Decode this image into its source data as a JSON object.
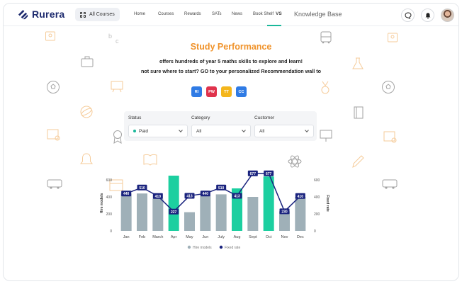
{
  "brand": {
    "name": "Rurera"
  },
  "nav": {
    "all_courses": "All Courses",
    "items": [
      "Home",
      "Courses",
      "Rewards",
      "SATs",
      "News",
      "Book Shelf"
    ],
    "vs": "VS",
    "knowledge_base": "Knowledge Base"
  },
  "icons": {
    "logo": "rurera-logo-icon",
    "grid": "grid-icon",
    "chat": "chat-icon",
    "bell": "bell-icon",
    "avatar": "user-avatar"
  },
  "hero": {
    "title": "Study Performance",
    "line1": "offers hundreds of year 5 maths skills to explore and learn!",
    "line2": "not sure where to start? GO to your personalized Recommendation wall to"
  },
  "chips": [
    {
      "label": "RI",
      "color": "#2f7be5"
    },
    {
      "label": "PW",
      "color": "#e0334c"
    },
    {
      "label": "TT",
      "color": "#f4b61c"
    },
    {
      "label": "CC",
      "color": "#2f7be5"
    }
  ],
  "filters": {
    "status": {
      "label": "Status",
      "value": "Paid"
    },
    "category": {
      "label": "Category",
      "value": "All"
    },
    "customer": {
      "label": "Customer",
      "value": "All"
    }
  },
  "colors": {
    "accent_orange": "#f0932b",
    "bar_gray": "#9fb0b8",
    "bar_green": "#1ccfa0",
    "line_navy": "#1a237e"
  },
  "chart_data": {
    "type": "bar",
    "categories": [
      "Jan",
      "Feb",
      "March",
      "Apr",
      "May",
      "Jun",
      "July",
      "Aug",
      "Sept",
      "Oct",
      "Nov",
      "Dec"
    ],
    "ylabel_left": "Hire models",
    "ylabel_right": "Fixed rate",
    "yticks": [
      0,
      200,
      400,
      600
    ],
    "ylim": [
      0,
      650
    ],
    "series": [
      {
        "name": "Hire models",
        "kind": "bar",
        "values": [
          440,
          440,
          380,
          650,
          220,
          410,
          430,
          500,
          400,
          640,
          230,
          400
        ],
        "highlight": [
          false,
          false,
          false,
          true,
          false,
          false,
          false,
          true,
          false,
          true,
          false,
          false
        ]
      },
      {
        "name": "Fixed rate",
        "kind": "line",
        "values": [
          440,
          510,
          410,
          227,
          413,
          440,
          510,
          413,
          677,
          677,
          230,
          410
        ]
      }
    ],
    "legend": [
      "Hire models",
      "Fixed rate"
    ]
  }
}
